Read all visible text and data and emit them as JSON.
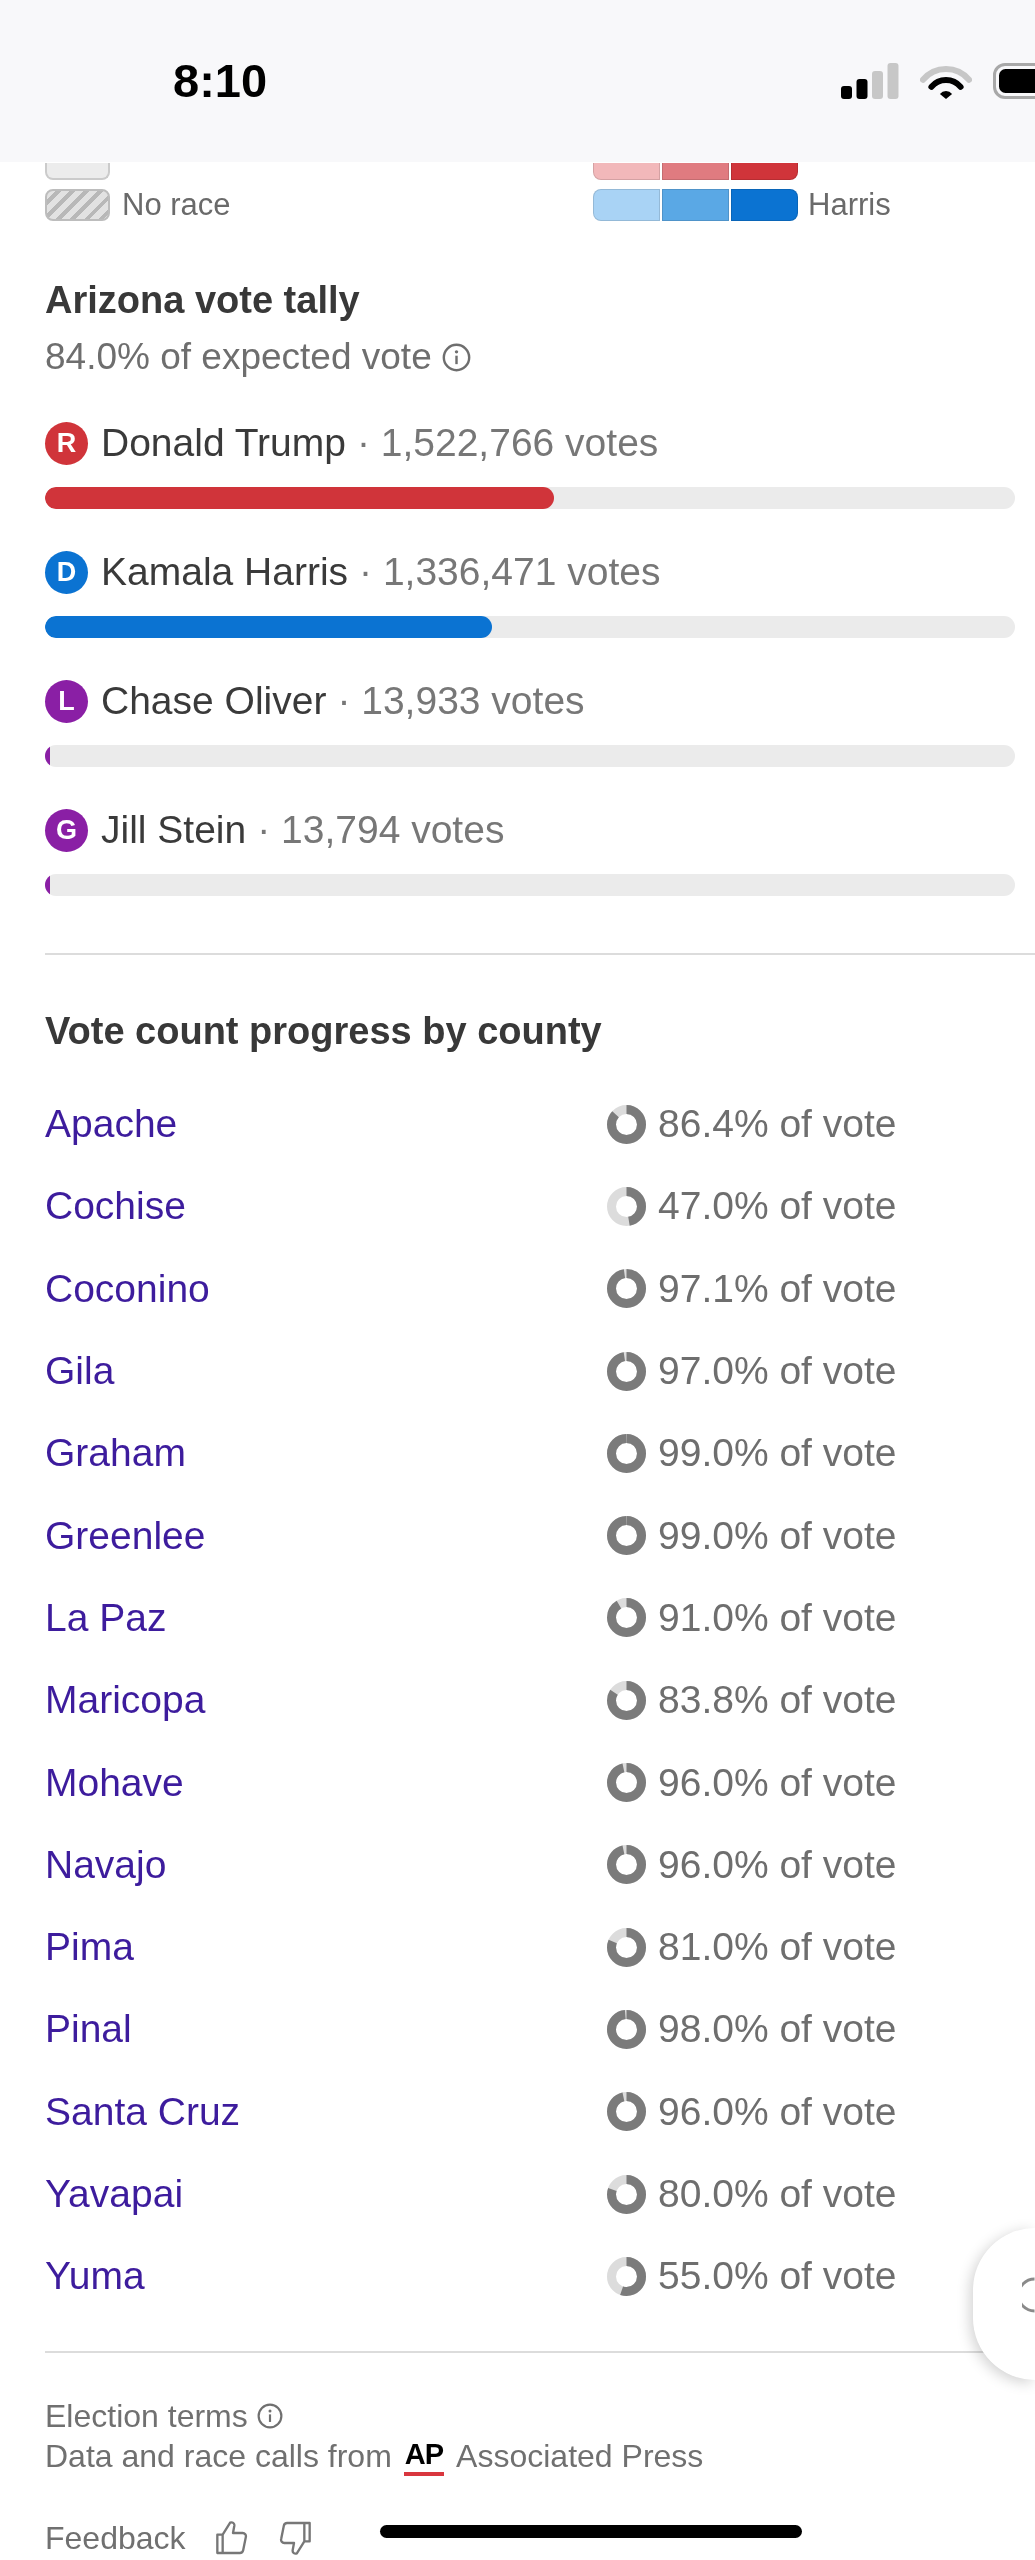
{
  "status_bar": {
    "time": "8:10"
  },
  "legend": {
    "states": [
      {
        "kind": "blank",
        "cut_off": true
      },
      {
        "label": "No race",
        "kind": "hatched",
        "cut_off": false
      }
    ],
    "candidates": [
      {
        "cut_off": true,
        "swatches": [
          {
            "color": "#f2b8ba"
          },
          {
            "color": "#e07b80"
          },
          {
            "color": "#d0343a"
          }
        ]
      },
      {
        "label": "Harris",
        "cut_off": false,
        "swatches": [
          {
            "color": "#a9d3f5"
          },
          {
            "color": "#5aa8e5"
          },
          {
            "color": "#0b73d2"
          }
        ]
      }
    ]
  },
  "tally": {
    "title": "Arizona vote tally",
    "subtitle": "84.0% of expected vote",
    "candidates": [
      {
        "party": "R",
        "name": "Donald Trump",
        "votes": "· 1,522,766 votes",
        "color": "#d0343a",
        "level": 0.525
      },
      {
        "party": "D",
        "name": "Kamala Harris",
        "votes": "· 1,336,471 votes",
        "color": "#0b73d2",
        "level": 0.461
      },
      {
        "party": "L",
        "name": "Chase Oliver",
        "votes": "· 13,933 votes",
        "color": "#8a1fa5",
        "level": 0.005
      },
      {
        "party": "G",
        "name": "Jill Stein",
        "votes": "· 13,794 votes",
        "color": "#8a1fa5",
        "level": 0.005
      }
    ]
  },
  "county_progress": {
    "title": "Vote count progress by county",
    "counties": [
      {
        "name": "Apache",
        "reading": "86.4% of vote",
        "level": 0.864
      },
      {
        "name": "Cochise",
        "reading": "47.0% of vote",
        "level": 0.47
      },
      {
        "name": "Coconino",
        "reading": "97.1% of vote",
        "level": 0.971
      },
      {
        "name": "Gila",
        "reading": "97.0% of vote",
        "level": 0.97
      },
      {
        "name": "Graham",
        "reading": "99.0% of vote",
        "level": 0.99
      },
      {
        "name": "Greenlee",
        "reading": "99.0% of vote",
        "level": 0.99
      },
      {
        "name": "La Paz",
        "reading": "91.0% of vote",
        "level": 0.91
      },
      {
        "name": "Maricopa",
        "reading": "83.8% of vote",
        "level": 0.838
      },
      {
        "name": "Mohave",
        "reading": "96.0% of vote",
        "level": 0.96
      },
      {
        "name": "Navajo",
        "reading": "96.0% of vote",
        "level": 0.96
      },
      {
        "name": "Pima",
        "reading": "81.0% of vote",
        "level": 0.81
      },
      {
        "name": "Pinal",
        "reading": "98.0% of vote",
        "level": 0.98
      },
      {
        "name": "Santa Cruz",
        "reading": "96.0% of vote",
        "level": 0.96
      },
      {
        "name": "Yavapai",
        "reading": "80.0% of vote",
        "level": 0.8
      },
      {
        "name": "Yuma",
        "reading": "55.0% of vote",
        "level": 0.55
      }
    ]
  },
  "footer": {
    "terms": "Election terms",
    "source": "Data and race calls from",
    "source_logo": "AP",
    "source_name": "Associated Press",
    "feedback": "Feedback"
  }
}
